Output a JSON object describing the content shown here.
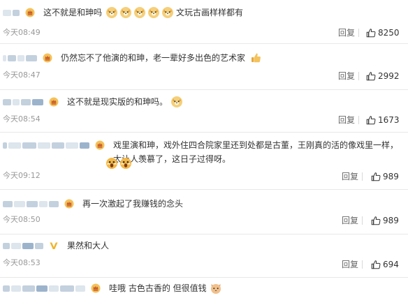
{
  "comments": [
    {
      "text": "这不就是和珅吗",
      "text_after": "文玩古画样样都有",
      "time": "今天08:49",
      "reply": "回复",
      "likes": "8250",
      "emoji": "doge-face-icon"
    },
    {
      "text": "仍然忘不了他演的和珅，老一辈好多出色的艺术家",
      "time": "今天08:47",
      "reply": "回复",
      "likes": "2992",
      "emoji": "thumbs-up-icon"
    },
    {
      "text": "这不就是现实版的和珅吗。",
      "time": "今天08:54",
      "reply": "回复",
      "likes": "1673",
      "emoji": "doge-face-icon"
    },
    {
      "text": "戏里演和珅，戏外住四合院家里还到处都是古董，王刚真的活的像戏里一样，太让人羡慕了，这日子过得呀。",
      "time": "今天09:12",
      "reply": "回复",
      "likes": "989",
      "emoji": "awe-face-icon"
    },
    {
      "text": "再一次激起了我赚钱的念头",
      "time": "今天08:50",
      "reply": "回复",
      "likes": "989"
    },
    {
      "text": "果然和大人",
      "time": "今天08:53",
      "reply": "回复",
      "likes": "694",
      "badge": "verified-v-icon"
    },
    {
      "text": "哇哦 古色古香的 但很值钱",
      "emoji": "cat-face-icon"
    }
  ],
  "colors": {
    "crown": "#e8a33a",
    "crown_dark": "#c95c2a",
    "doge": "#f4c35d",
    "awe": "#f2b233",
    "text": "#333333",
    "meta": "#999999",
    "divider": "#e8e8e8"
  }
}
